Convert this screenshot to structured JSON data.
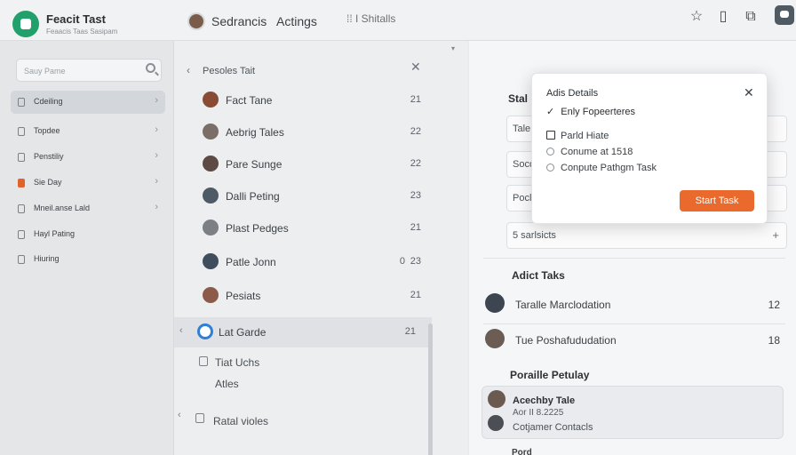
{
  "app": {
    "title": "Feacit Tast",
    "subtitle": "Feaacis Taas Sasipam"
  },
  "topbar": {
    "links": [
      "Sedrancis",
      "Actings"
    ],
    "grid_label": "⁞⁞ I Shitalls",
    "icons": [
      "star-icon",
      "book-icon",
      "share-icon",
      "chat-icon"
    ]
  },
  "sidebar": {
    "search_placeholder": "Sauy Pame",
    "items": [
      {
        "label": "Cdeiling",
        "icon": "doc-icon",
        "active": true
      },
      {
        "label": "Topdee",
        "icon": "link-icon"
      },
      {
        "label": "Penstiliy",
        "icon": "doc-icon"
      },
      {
        "label": "Sie Day",
        "icon": "orange-dot-icon"
      },
      {
        "label": "Mneil.anse Lald",
        "icon": "doc-icon"
      },
      {
        "label": "Hayl Pating",
        "icon": "doc-icon"
      },
      {
        "label": "Hiuring",
        "icon": "list-icon"
      }
    ]
  },
  "list": {
    "title": "Pesoles Tait",
    "rows": [
      {
        "name": "Fact Tane",
        "value": "21",
        "avatar_color": "#8a4b35"
      },
      {
        "name": "Aebrig Tales",
        "value": "22",
        "avatar_color": "#7a6e66"
      },
      {
        "name": "Pare Sunge",
        "value": "22",
        "avatar_color": "#5d4a44"
      },
      {
        "name": "Dalli Peting",
        "value": "23",
        "avatar_color": "#4e5a66"
      },
      {
        "name": "Plast Pedges",
        "value": "21",
        "avatar_color": "#7c7f83"
      },
      {
        "name": "Patle Jonn",
        "value": "23",
        "extra": "0",
        "avatar_color": "#3f4d5c"
      },
      {
        "name": "Pesiats",
        "value": "21",
        "avatar_color": "#8b5a48"
      },
      {
        "name": "Lat Garde",
        "value": "21",
        "avatar_color": "#2f7fd6",
        "selected": true
      }
    ],
    "sub_items": [
      "Tiat Uchs",
      "Atles",
      "Ratal violes"
    ]
  },
  "detail": {
    "section_label": "Stal",
    "fields": [
      "Tale",
      "Socd",
      "Pocl",
      "5 sarlsicts"
    ],
    "active_tasks_title": "Adict Taks",
    "tasks": [
      {
        "name": "Taralle Marclodation",
        "value": "12",
        "avatar_color": "#3d4650"
      },
      {
        "name": "Tue Poshafududation",
        "value": "18",
        "avatar_color": "#6b5c54"
      }
    ],
    "profile_title": "Poraille Petulay",
    "card": {
      "title": "Acechby Tale",
      "date": "Aor II 8.2225",
      "contacts": "Cotjamer Contacls"
    },
    "bottom_label": "Pord"
  },
  "modal": {
    "title": "Adis Details",
    "checked_option": "Enly Fopeerteres",
    "checkbox_option": "Parld Hiate",
    "radio_options": [
      "Conume at 1518",
      "Conpute Pathgm Task"
    ],
    "button": "Start Task",
    "accent": "#ea6a2d"
  }
}
